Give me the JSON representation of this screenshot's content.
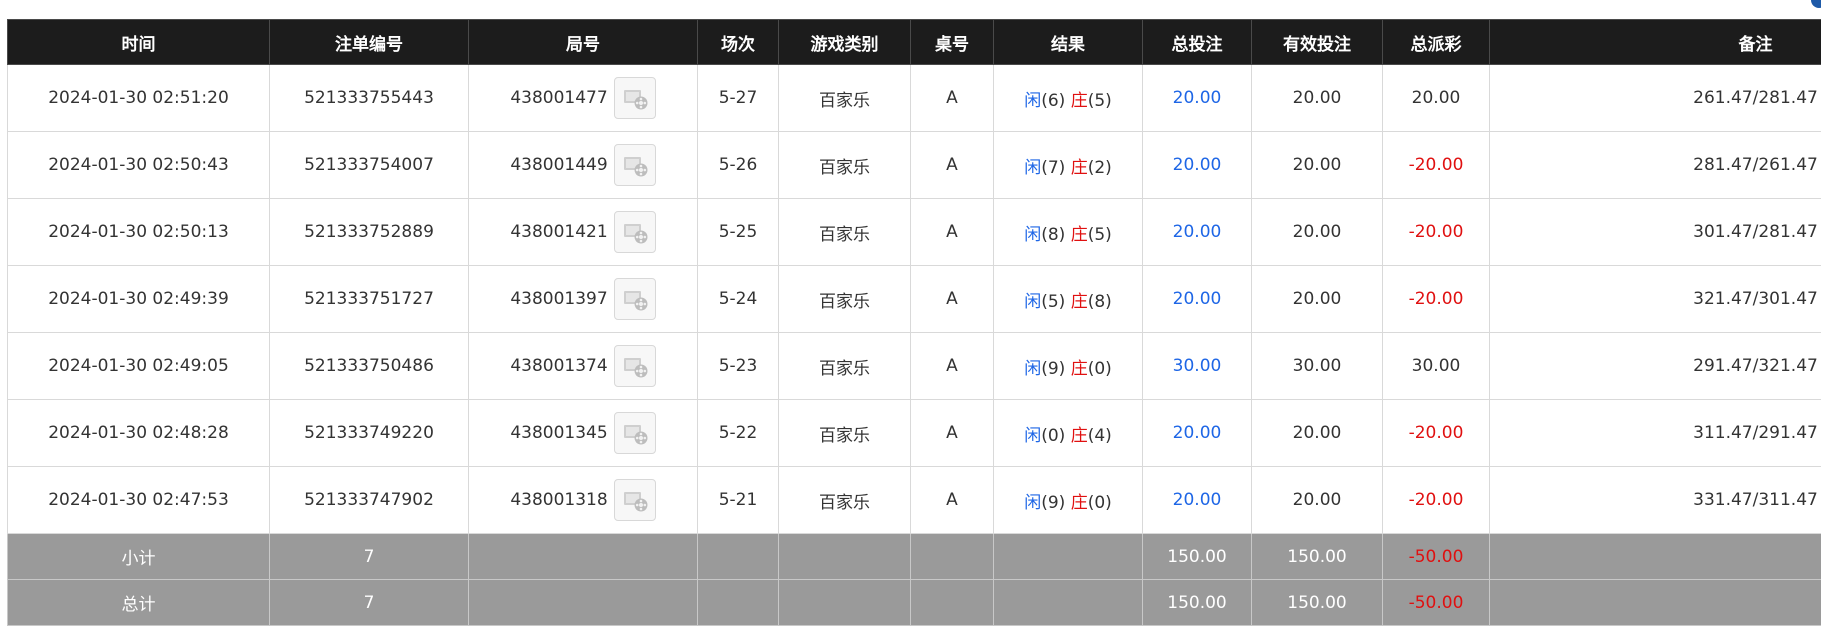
{
  "table": {
    "headers": [
      "时间",
      "注单编号",
      "局号",
      "场次",
      "游戏类别",
      "桌号",
      "结果",
      "总投注",
      "有效投注",
      "总派彩",
      "备注"
    ],
    "rows": [
      {
        "time": "2024-01-30 02:51:20",
        "bet_no": "521333755443",
        "round": "438001477",
        "session": "5-27",
        "game": "百家乐",
        "table": "A",
        "player_label": "闲",
        "player_val": "(6)",
        "banker_label": "庄",
        "banker_val": "(5)",
        "total_bet": "20.00",
        "valid_bet": "20.00",
        "payout": "20.00",
        "payout_negative": false,
        "remark": "261.47/281.47"
      },
      {
        "time": "2024-01-30 02:50:43",
        "bet_no": "521333754007",
        "round": "438001449",
        "session": "5-26",
        "game": "百家乐",
        "table": "A",
        "player_label": "闲",
        "player_val": "(7)",
        "banker_label": "庄",
        "banker_val": "(2)",
        "total_bet": "20.00",
        "valid_bet": "20.00",
        "payout": "-20.00",
        "payout_negative": true,
        "remark": "281.47/261.47"
      },
      {
        "time": "2024-01-30 02:50:13",
        "bet_no": "521333752889",
        "round": "438001421",
        "session": "5-25",
        "game": "百家乐",
        "table": "A",
        "player_label": "闲",
        "player_val": "(8)",
        "banker_label": "庄",
        "banker_val": "(5)",
        "total_bet": "20.00",
        "valid_bet": "20.00",
        "payout": "-20.00",
        "payout_negative": true,
        "remark": "301.47/281.47"
      },
      {
        "time": "2024-01-30 02:49:39",
        "bet_no": "521333751727",
        "round": "438001397",
        "session": "5-24",
        "game": "百家乐",
        "table": "A",
        "player_label": "闲",
        "player_val": "(5)",
        "banker_label": "庄",
        "banker_val": "(8)",
        "total_bet": "20.00",
        "valid_bet": "20.00",
        "payout": "-20.00",
        "payout_negative": true,
        "remark": "321.47/301.47"
      },
      {
        "time": "2024-01-30 02:49:05",
        "bet_no": "521333750486",
        "round": "438001374",
        "session": "5-23",
        "game": "百家乐",
        "table": "A",
        "player_label": "闲",
        "player_val": "(9)",
        "banker_label": "庄",
        "banker_val": "(0)",
        "total_bet": "30.00",
        "valid_bet": "30.00",
        "payout": "30.00",
        "payout_negative": false,
        "remark": "291.47/321.47"
      },
      {
        "time": "2024-01-30 02:48:28",
        "bet_no": "521333749220",
        "round": "438001345",
        "session": "5-22",
        "game": "百家乐",
        "table": "A",
        "player_label": "闲",
        "player_val": "(0)",
        "banker_label": "庄",
        "banker_val": "(4)",
        "total_bet": "20.00",
        "valid_bet": "20.00",
        "payout": "-20.00",
        "payout_negative": true,
        "remark": "311.47/291.47"
      },
      {
        "time": "2024-01-30 02:47:53",
        "bet_no": "521333747902",
        "round": "438001318",
        "session": "5-21",
        "game": "百家乐",
        "table": "A",
        "player_label": "闲",
        "player_val": "(9)",
        "banker_label": "庄",
        "banker_val": "(0)",
        "total_bet": "20.00",
        "valid_bet": "20.00",
        "payout": "-20.00",
        "payout_negative": true,
        "remark": "331.47/311.47"
      }
    ],
    "subtotal": {
      "label": "小计",
      "count": "7",
      "total_bet": "150.00",
      "valid_bet": "150.00",
      "payout": "-50.00"
    },
    "grandtotal": {
      "label": "总计",
      "count": "7",
      "total_bet": "150.00",
      "valid_bet": "150.00",
      "payout": "-50.00"
    }
  },
  "colors": {
    "header_bg": "#1c1c1c",
    "footer_bg": "#9a9a9a",
    "player": "#1e66e6",
    "banker": "#e01010",
    "negative": "#e01010",
    "bet": "#1e66e6"
  },
  "icons": {
    "replay": "video-replay-icon"
  }
}
